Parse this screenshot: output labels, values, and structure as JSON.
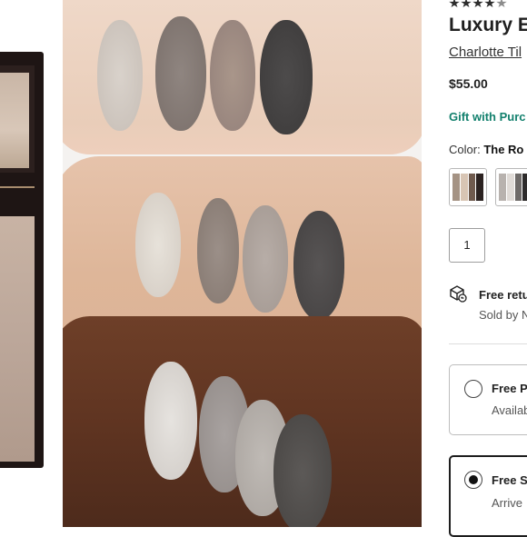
{
  "product": {
    "rating": "4.5/5",
    "title": "Luxury Ey",
    "brand": "Charlotte Til",
    "price": "$55.00",
    "promo": "Gift with Purc",
    "color_label": "Color:",
    "color_value": "The Ro",
    "quantity": "1"
  },
  "shipping": {
    "returns": "Free retu",
    "sold_by": "Sold by N"
  },
  "fulfillment": {
    "options": [
      {
        "title": "Free P",
        "subtitle": "Availab",
        "selected": false
      },
      {
        "title": "Free S",
        "subtitle": "Arrive",
        "selected": true
      }
    ]
  },
  "icons": {
    "returns_icon": "box-return-icon",
    "rating_icon": "star-icon"
  },
  "colors": {
    "promo_green": "#12806d",
    "accent_dark": "#1d1d1d"
  }
}
